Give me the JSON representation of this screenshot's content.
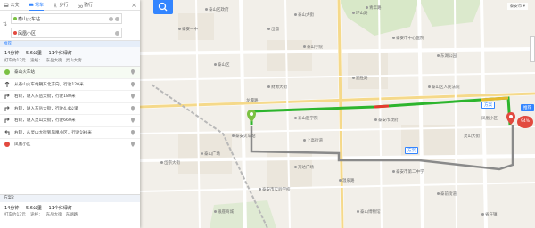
{
  "modes": [
    {
      "name": "bus",
      "label": "公交",
      "active": false
    },
    {
      "name": "drive",
      "label": "驾车",
      "active": true
    },
    {
      "name": "walk",
      "label": "步行",
      "active": false
    },
    {
      "name": "bike",
      "label": "骑行",
      "active": false
    }
  ],
  "origin": "泰山火车站",
  "destination": "凤凰小区",
  "scheme1": {
    "tag": "推荐",
    "duration": "14分钟",
    "distance": "5.6公里",
    "lights": "11个红绿灯",
    "taxi": "打车约13元",
    "via_label": "途经：",
    "via": [
      "东岳大街",
      "灵山大街"
    ]
  },
  "steps": [
    {
      "icon": "start-icon",
      "text": "泰山火车站"
    },
    {
      "icon": "straight-icon",
      "text": "从泰山火车站朝东北方向，行驶120米"
    },
    {
      "icon": "turn-right-icon",
      "text": "右转，进入东岳大街，行驶180米"
    },
    {
      "icon": "turn-right-icon",
      "text": "右转，进入东岳大街，行驶4.4公里"
    },
    {
      "icon": "turn-right-icon",
      "text": "右转，进入灵山大街，行驶660米"
    },
    {
      "icon": "turn-left-icon",
      "text": "右转，从灵山大街到凤凰小区，行驶190米"
    },
    {
      "icon": "end-icon",
      "text": "凤凰小区"
    }
  ],
  "scheme2": {
    "header": "方案2",
    "duration": "14分钟",
    "distance": "5.6公里",
    "lights": "11个红绿灯",
    "taxi": "打车约13元",
    "via_label": "途经：",
    "via": [
      "东岳大街",
      "东湖路"
    ]
  },
  "city": "泰安市",
  "map": {
    "callout_1": "方案",
    "callout_2": "方案",
    "dest_badge": "推荐",
    "dest_badge_2": "94%",
    "pois": [
      "泰山区政府",
      "泰山大街",
      "青年路",
      "泰安一中",
      "岱庙",
      "环山路",
      "泰安市中心医院",
      "泰山学院",
      "东湖公园",
      "泰山区",
      "龙潭路",
      "迎胜路",
      "财源大街",
      "泰安市政府",
      "泰山医学院",
      "泰山区人民法院",
      "泰安火车站",
      "灵山大街",
      "凤凰小区",
      "岱宗大街",
      "泰安市第二中学",
      "泰山广场",
      "万达广场",
      "泰安市实验学校",
      "温泉路",
      "泰前街道",
      "银座商城",
      "泰山博物馆",
      "省庄镇",
      "上高街道"
    ]
  },
  "colors": {
    "accent": "#3385ff",
    "route_main": "#2db52d",
    "route_alt": "#8a8a8a",
    "route_red": "#e63b2e",
    "origin_pin": "#7bc142",
    "dest_pin": "#e24a3f"
  }
}
